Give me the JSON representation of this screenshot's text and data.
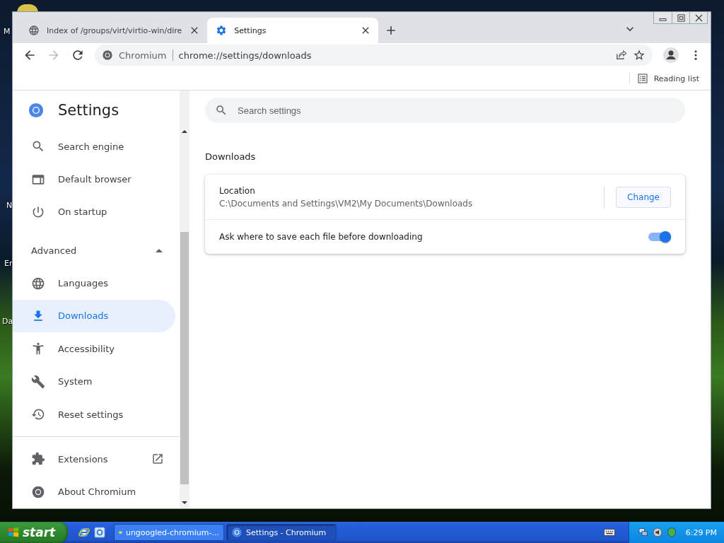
{
  "desktop": {
    "icon_labels": [
      "M",
      "N",
      "Er",
      "Da"
    ]
  },
  "browser": {
    "tabs": [
      {
        "title": "Index of /groups/virt/virtio-win/dire",
        "selected": false
      },
      {
        "title": "Settings",
        "selected": true
      }
    ],
    "omnibox": {
      "origin": "Chromium",
      "url": "chrome://settings/downloads"
    },
    "bookmarks_bar": {
      "reading_list": "Reading list"
    }
  },
  "settings": {
    "title": "Settings",
    "search": {
      "placeholder": "Search settings"
    },
    "sidebar": {
      "items": [
        {
          "label": "Search engine",
          "selected": false
        },
        {
          "label": "Default browser",
          "selected": false
        },
        {
          "label": "On startup",
          "selected": false
        }
      ],
      "advanced": {
        "label": "Advanced",
        "expanded": true,
        "items": [
          {
            "label": "Languages",
            "selected": false
          },
          {
            "label": "Downloads",
            "selected": true
          },
          {
            "label": "Accessibility",
            "selected": false
          },
          {
            "label": "System",
            "selected": false
          },
          {
            "label": "Reset settings",
            "selected": false
          }
        ]
      },
      "footer": [
        {
          "label": "Extensions",
          "selected": false
        },
        {
          "label": "About Chromium",
          "selected": false
        }
      ]
    },
    "section": {
      "title": "Downloads",
      "rows": [
        {
          "kind": "location",
          "label": "Location",
          "value": "C:\\Documents and Settings\\VM2\\My Documents\\Downloads",
          "button": "Change"
        },
        {
          "kind": "toggle",
          "label": "Ask where to save each file before downloading",
          "on": true
        }
      ]
    }
  },
  "taskbar": {
    "start": "start",
    "tasks": [
      {
        "label": "ungoogled-chromium-...",
        "selected": false
      },
      {
        "label": "Settings - Chromium",
        "selected": true
      }
    ],
    "clock": "6:29 PM"
  }
}
